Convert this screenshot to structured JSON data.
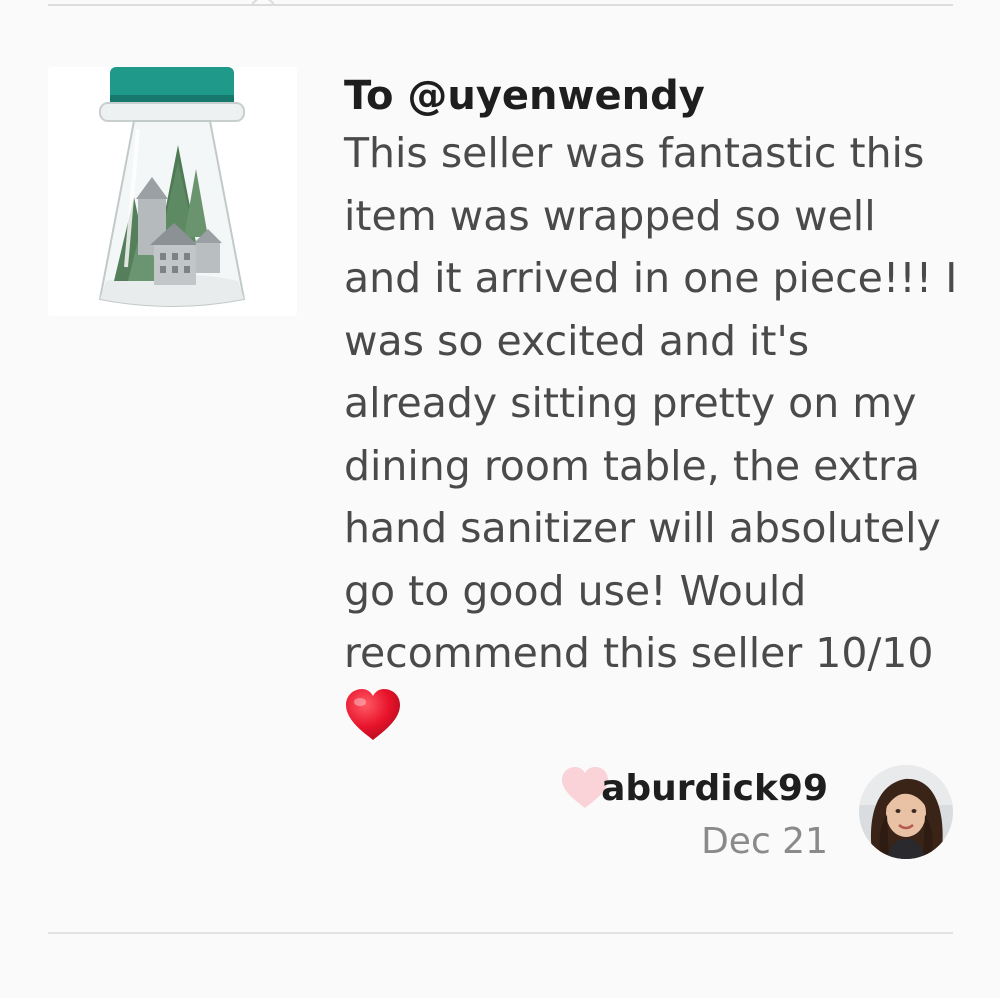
{
  "review": {
    "recipient": "To @uyenwendy",
    "text_lines": [
      "This seller was fantastic this",
      "item was wrapped so well",
      "and it arrived in one piece!!! I",
      "was so excited and it's",
      "already sitting pretty on my",
      "dining room table, the extra",
      "hand sanitizer will absolutely",
      "go to good use! Would",
      "recommend this seller 10/10"
    ],
    "emoji": "red-heart-emoji"
  },
  "author": {
    "username": "aburdick99",
    "date": "Dec 21",
    "like_icon": "heart-outline-icon"
  },
  "colors": {
    "background": "#fafafa",
    "text_primary": "#1e1e1e",
    "text_body": "#4a4a4a",
    "text_muted": "#8a8a8a",
    "like_heart": "#f9d3d8",
    "jar_lid": "#1f9a8a",
    "emoji_heart": "#e8132b"
  }
}
